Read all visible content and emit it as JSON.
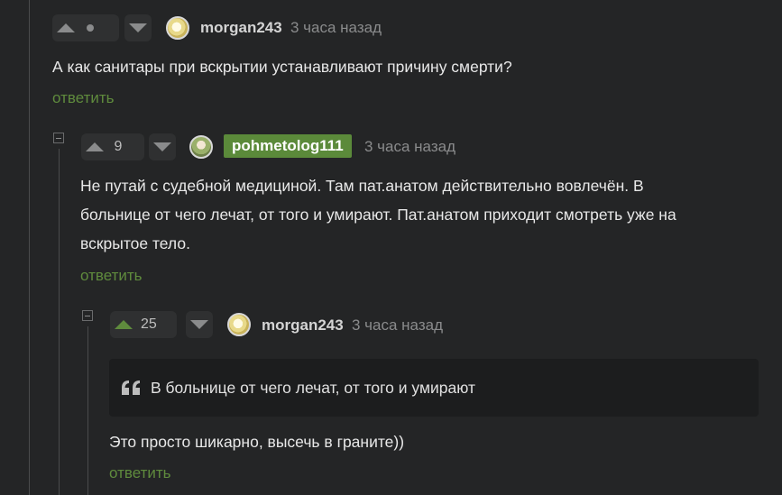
{
  "comments": [
    {
      "votes_count": "",
      "username": "morgan243",
      "timestamp": "3 часа назад",
      "text": "А как санитары при вскрытии устанавливают причину смерти?",
      "reply_label": "ответить",
      "avatar_icon": "gold-coin-avatar"
    },
    {
      "votes_count": "9",
      "username": "pohmetolog111",
      "timestamp": "3 часа назад",
      "text_lines": [
        "Не путай с судебной медициной. Там пат.анатом действительно вовлечён. В",
        "больнице от чего лечат, от того и умирают. Пат.анатом приходит смотреть уже на",
        "вскрытое тело."
      ],
      "reply_label": "ответить",
      "badge_color": "#5b8a3a",
      "avatar_icon": "green-avatar"
    },
    {
      "votes_count": "25",
      "username": "morgan243",
      "timestamp": "3 часа назад",
      "quote": "В больнице от чего лечат, от того и умирают",
      "text": "Это просто шикарно, высечь в граните))",
      "reply_label": "ответить",
      "upvote_color": "#5f8b3d",
      "avatar_icon": "gold-coin-avatar"
    }
  ],
  "colors": {
    "background": "#242526",
    "reply_link": "#5f8b3d",
    "muted": "#8a8b8c"
  }
}
